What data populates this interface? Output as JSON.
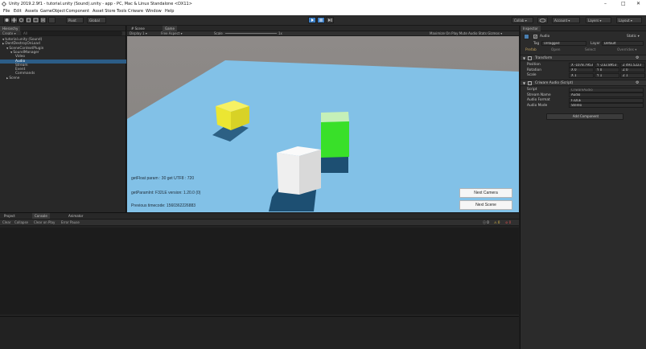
{
  "window": {
    "title": "Unity 2019.2.9f1 - tutorial.unity (Sound).unity - app - PC, Mac & Linux Standalone <DX11>",
    "minimize": "–",
    "maximize": "□",
    "close": "✕"
  },
  "menu": [
    "File",
    "Edit",
    "Assets",
    "GameObject",
    "Component",
    "Asset Store Tools",
    "Criware",
    "Window",
    "Help"
  ],
  "toolbar": {
    "pivot": "Pivot",
    "global": "Global",
    "collab": "Collab ▾",
    "account": "Account ▾",
    "layers": "Layers ▾",
    "layout": "Layout ▾"
  },
  "hierarchy": {
    "tab": "Hierarchy",
    "create": "Create ▾",
    "search_placeholder": "All",
    "items": [
      {
        "label": "tutorial.unity (Sound)",
        "indent": 0,
        "arrow": "▼"
      },
      {
        "label": "DontDestroyOnLoad",
        "indent": 0,
        "arrow": "▶"
      },
      {
        "label": "SceneContextPlugin",
        "indent": 1,
        "arrow": "▼"
      },
      {
        "label": "SoundManager",
        "indent": 2,
        "arrow": "▼"
      },
      {
        "label": "Video",
        "indent": 3,
        "arrow": ""
      },
      {
        "label": "Audio",
        "indent": 3,
        "arrow": "",
        "selected": true
      },
      {
        "label": "Stream",
        "indent": 3,
        "arrow": ""
      },
      {
        "label": "Event",
        "indent": 3,
        "arrow": ""
      },
      {
        "label": "Commands",
        "indent": 3,
        "arrow": ""
      },
      {
        "label": "Scene",
        "indent": 1,
        "arrow": "▶"
      }
    ]
  },
  "scene_tabs": {
    "scene": "# Scene",
    "game": "Game",
    "display": "Display 1 ▾",
    "aspect": "Free Aspect ▾",
    "scale_label": "Scale",
    "scale_value": "1x",
    "options": "Maximize On Play   Mute Audio   Stats   Gizmos ▾"
  },
  "game_view": {
    "label_1": "getFloat param : 30 get UTF8 : 720",
    "label_2": "getParamInt: F32LE version: 1.20.0 (0)",
    "label_3": "Previous timecode: 1560362226883",
    "button_next_camera": "Next Camera",
    "button_next_scene": "Next Scene",
    "colors": {
      "sky": "#8a8886",
      "floor": "#82c1e7",
      "yellow_cube": "#ece632",
      "green_cube": "#39e029",
      "white_cube": "#efefef",
      "shadow": "#1d4f72"
    }
  },
  "inspector": {
    "tab": "Inspector",
    "object_name": "Audio",
    "static_label": "Static ▾",
    "tag_label": "Tag",
    "tag_value": "Untagged",
    "layer_label": "Layer",
    "layer_value": "Default",
    "prefab_row": [
      "Prefab",
      "Open",
      "Select",
      "Overrides ▾"
    ],
    "transform": {
      "header": "Transform",
      "rows": [
        {
          "label": "Position",
          "x": "X -1078.7953",
          "y": "Y -232.8953",
          "z": "Z 491.5223"
        },
        {
          "label": "Rotation",
          "x": "X 0",
          "y": "Y 0",
          "z": "Z 0"
        },
        {
          "label": "Scale",
          "x": "X 1",
          "y": "Y 1",
          "z": "Z 1"
        }
      ]
    },
    "script_component": {
      "header": "Criware Audio (Script)",
      "rows": [
        {
          "label": "Script",
          "value": "CriwareAudio"
        },
        {
          "label": "Stream Name",
          "value": "Audio"
        },
        {
          "label": "Audio Format",
          "value": "F32LE"
        },
        {
          "label": "Audio Mode",
          "value": "Stereo"
        }
      ]
    },
    "add_component": "Add Component"
  },
  "console": {
    "tabs": [
      "Project",
      "Console",
      "Animator"
    ],
    "toolbar": [
      "Clear",
      "Collapse",
      "Clear on Play",
      "Error Pause"
    ],
    "counts": [
      "0",
      "0",
      "0"
    ]
  }
}
